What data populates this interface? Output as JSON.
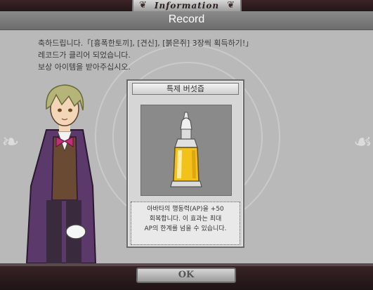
{
  "window": {
    "tab_title": "Information",
    "header_title": "Record"
  },
  "message": {
    "line1": "축하드립니다.「[흉폭한토끼], [견신], [붉은쥐] 3장씩 획득하기!」",
    "line2": "레코드가 클리어 되었습니다.",
    "line3": "보상 아이템을 받아주십시오."
  },
  "reward": {
    "item_name": "특제 버섯즙",
    "description_line1": "아바타의 행동력(AP)을 +50",
    "description_line2": "회복합니다. 이 효과는 최대",
    "description_line3": "AP의 한계를 넘을 수 있습니다."
  },
  "footer": {
    "ok_label": "OK"
  },
  "colors": {
    "panel_bg": "#b9b9b9",
    "header_bg": "#7c7c7c",
    "frame_dark": "#2a1a1c",
    "potion_gold": "#f2c21a"
  },
  "icons": {
    "item": "potion-bottle-icon",
    "ornament": "swirl-ornament-icon"
  }
}
